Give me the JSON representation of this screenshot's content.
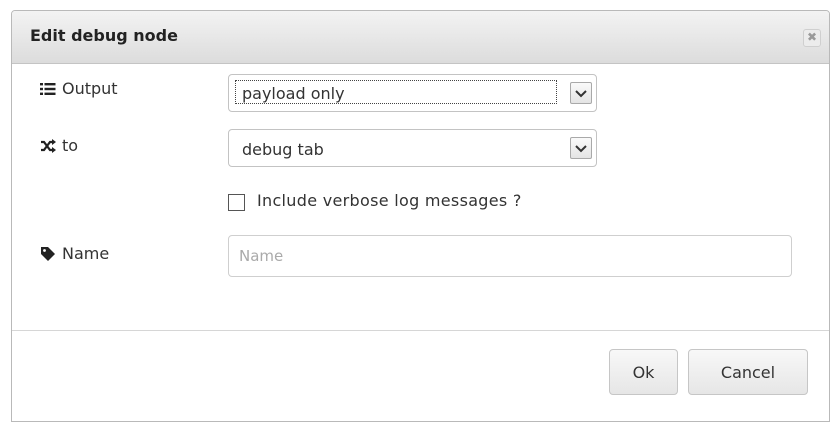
{
  "dialog": {
    "title": "Edit debug node",
    "close_glyph": "✖"
  },
  "output": {
    "label": "Output",
    "icon": "list-icon",
    "selected": "payload only"
  },
  "to": {
    "label": "to",
    "icon": "random-icon",
    "selected": "debug tab"
  },
  "verbose": {
    "label": "Include verbose log messages ?",
    "checked": false
  },
  "name": {
    "label": "Name",
    "icon": "tag-icon",
    "value": "",
    "placeholder": "Name"
  },
  "buttons": {
    "ok": "Ok",
    "cancel": "Cancel"
  }
}
